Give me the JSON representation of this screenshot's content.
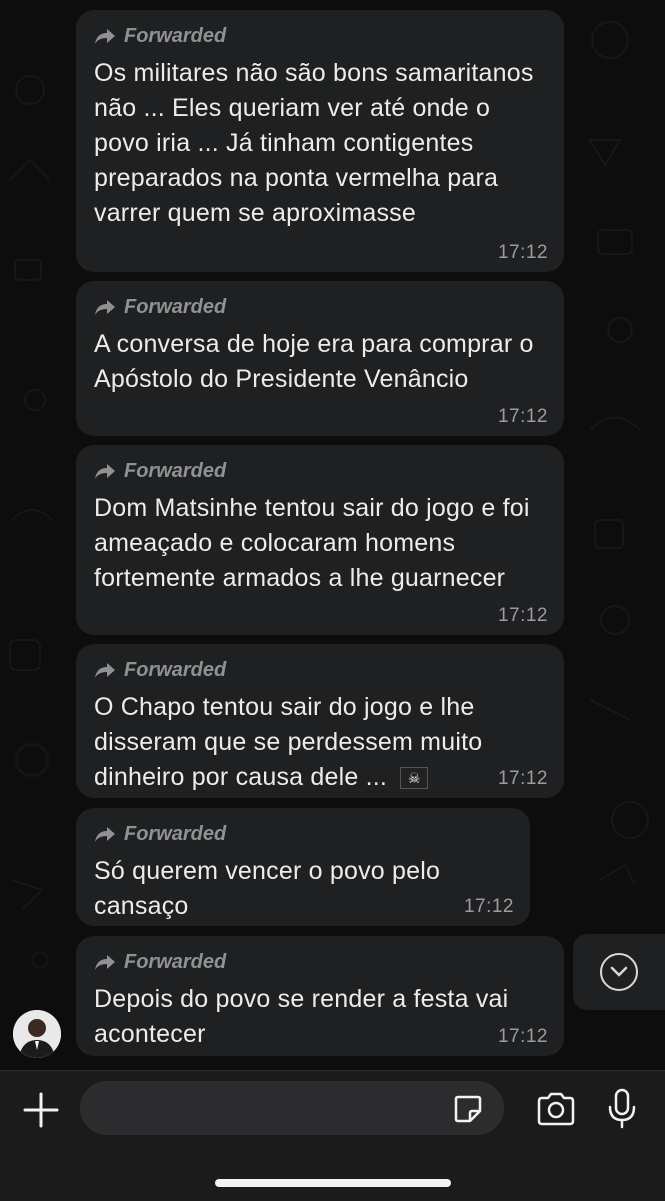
{
  "forwarded_label": "Forwarded",
  "messages": [
    {
      "text": "Os militares não são bons samaritanos não ... Eles queriam ver até onde o povo iria ... Já tinham contigentes preparados na ponta vermelha para varrer quem se aproximasse",
      "time": "17:12"
    },
    {
      "text": "A conversa de hoje era para comprar o Apóstolo do Presidente Venâncio",
      "time": "17:12"
    },
    {
      "text": "Dom Matsinhe tentou sair do jogo e foi ameaçado e colocaram homens fortemente armados a lhe guarnecer",
      "time": "17:12"
    },
    {
      "text": "O Chapo tentou sair do jogo e lhe disseram que se perdessem muito dinheiro por causa dele ...",
      "time": "17:12",
      "emoji": "pirate-flag"
    },
    {
      "text": "Só querem vencer o povo pelo cansaço",
      "time": "17:12"
    },
    {
      "text": "Depois do povo se render a festa vai acontecer",
      "time": "17:12"
    }
  ],
  "composer": {
    "input_value": "",
    "icons": [
      "plus-icon",
      "sticker-icon",
      "camera-icon",
      "microphone-icon"
    ]
  },
  "colors": {
    "bubble": "#1f2021",
    "background": "#0d0d0d",
    "text": "#ececec",
    "meta": "#9b9c9e"
  }
}
